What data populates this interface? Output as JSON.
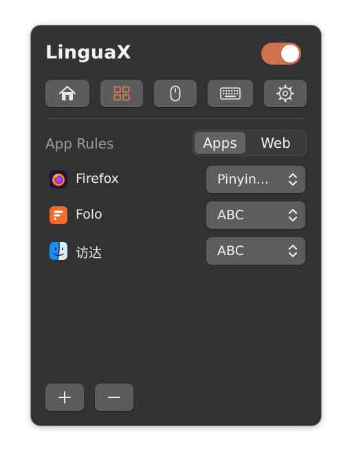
{
  "app": {
    "title": "LinguaX",
    "enabled": true
  },
  "toolbar": [
    {
      "name": "home-tab-button",
      "icon": "home-icon"
    },
    {
      "name": "app-rules-tab-button",
      "icon": "grid-icon",
      "active": true
    },
    {
      "name": "mouse-tab-button",
      "icon": "mouse-icon"
    },
    {
      "name": "keyboard-tab-button",
      "icon": "keyboard-icon"
    },
    {
      "name": "settings-tab-button",
      "icon": "gear-icon"
    }
  ],
  "section": {
    "title": "App Rules",
    "segments": [
      "Apps",
      "Web"
    ],
    "active_segment": "Apps"
  },
  "rules": [
    {
      "app": "Firefox",
      "icon": "firefox-icon",
      "input_source": "Pinyin..."
    },
    {
      "app": "Folo",
      "icon": "folo-icon",
      "input_source": "ABC"
    },
    {
      "app": "访达",
      "icon": "finder-icon",
      "input_source": "ABC"
    }
  ],
  "footer": {
    "add_icon": "plus-icon",
    "remove_icon": "minus-icon"
  },
  "colors": {
    "accent": "#d2714f",
    "panel": "#323232",
    "button": "#5b5b5b"
  }
}
